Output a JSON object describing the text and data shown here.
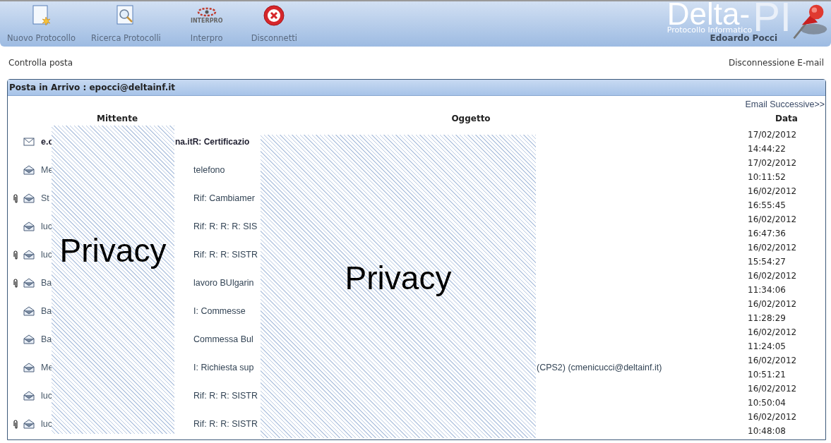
{
  "toolbar": [
    {
      "kind": "new",
      "label": "Nuovo Protocollo"
    },
    {
      "kind": "search",
      "label": "Ricerca Protocolli"
    },
    {
      "kind": "interpro",
      "label": "Interpro",
      "logo_text": "INTERPRO"
    },
    {
      "kind": "disconnect",
      "label": "Disconnetti"
    }
  ],
  "brand": {
    "name": "Delta-",
    "suffix": "PI",
    "subtitle": "Protocollo Informatico",
    "user": "Edoardo Pocci"
  },
  "links": {
    "left": "Controlla posta",
    "right": "Disconnessione E-mail"
  },
  "inbox": {
    "title": "Posta in Arrivo : epocci@deltainf.it",
    "next": "Email Successive>>",
    "columns": [
      "Mittente",
      "Oggetto",
      "Data"
    ],
    "rows": [
      {
        "sender": "e.c",
        "sender_tail": "na.itR: Certificazio",
        "subject": "",
        "unread": true,
        "attachment": false,
        "date": "17/02/2012",
        "time": "14:44:22"
      },
      {
        "sender": "Me",
        "subject": "telefono",
        "unread": false,
        "attachment": false,
        "date": "17/02/2012",
        "time": "10:11:52"
      },
      {
        "sender": "St",
        "subject": "Rif: Cambiamer",
        "unread": false,
        "attachment": true,
        "date": "16/02/2012",
        "time": "16:55:45"
      },
      {
        "sender": "luc",
        "subject": "Rif: R: R: R: SIS",
        "unread": false,
        "attachment": false,
        "date": "16/02/2012",
        "time": "16:47:36"
      },
      {
        "sender": "luc",
        "subject": "Rif: R: R: SISTR",
        "unread": false,
        "attachment": true,
        "date": "16/02/2012",
        "time": "15:54:27"
      },
      {
        "sender": "Ba",
        "subject": "lavoro BUlgarin",
        "unread": false,
        "attachment": true,
        "date": "16/02/2012",
        "time": "11:34:06"
      },
      {
        "sender": "Ba",
        "subject": "I: Commesse",
        "unread": false,
        "attachment": false,
        "date": "16/02/2012",
        "time": "11:28:29"
      },
      {
        "sender": "Ba",
        "subject": "Commessa Bul",
        "unread": false,
        "attachment": false,
        "date": "16/02/2012",
        "time": "11:24:05"
      },
      {
        "sender": "Me",
        "subject": "I: Richiesta sup",
        "subject_tail": "(CPS2) (cmenicucci@deltainf.it)",
        "unread": false,
        "attachment": false,
        "date": "16/02/2012",
        "time": "10:51:21"
      },
      {
        "sender": "luc",
        "subject": "Rif: R: R: SISTR",
        "unread": false,
        "attachment": false,
        "date": "16/02/2012",
        "time": "10:50:04"
      },
      {
        "sender": "luc",
        "subject": "Rif: R: R: SISTR",
        "unread": false,
        "attachment": true,
        "date": "16/02/2012",
        "time": "10:48:08"
      }
    ]
  },
  "redactions": [
    {
      "label": "Privacy"
    },
    {
      "label": "Privacy"
    }
  ]
}
